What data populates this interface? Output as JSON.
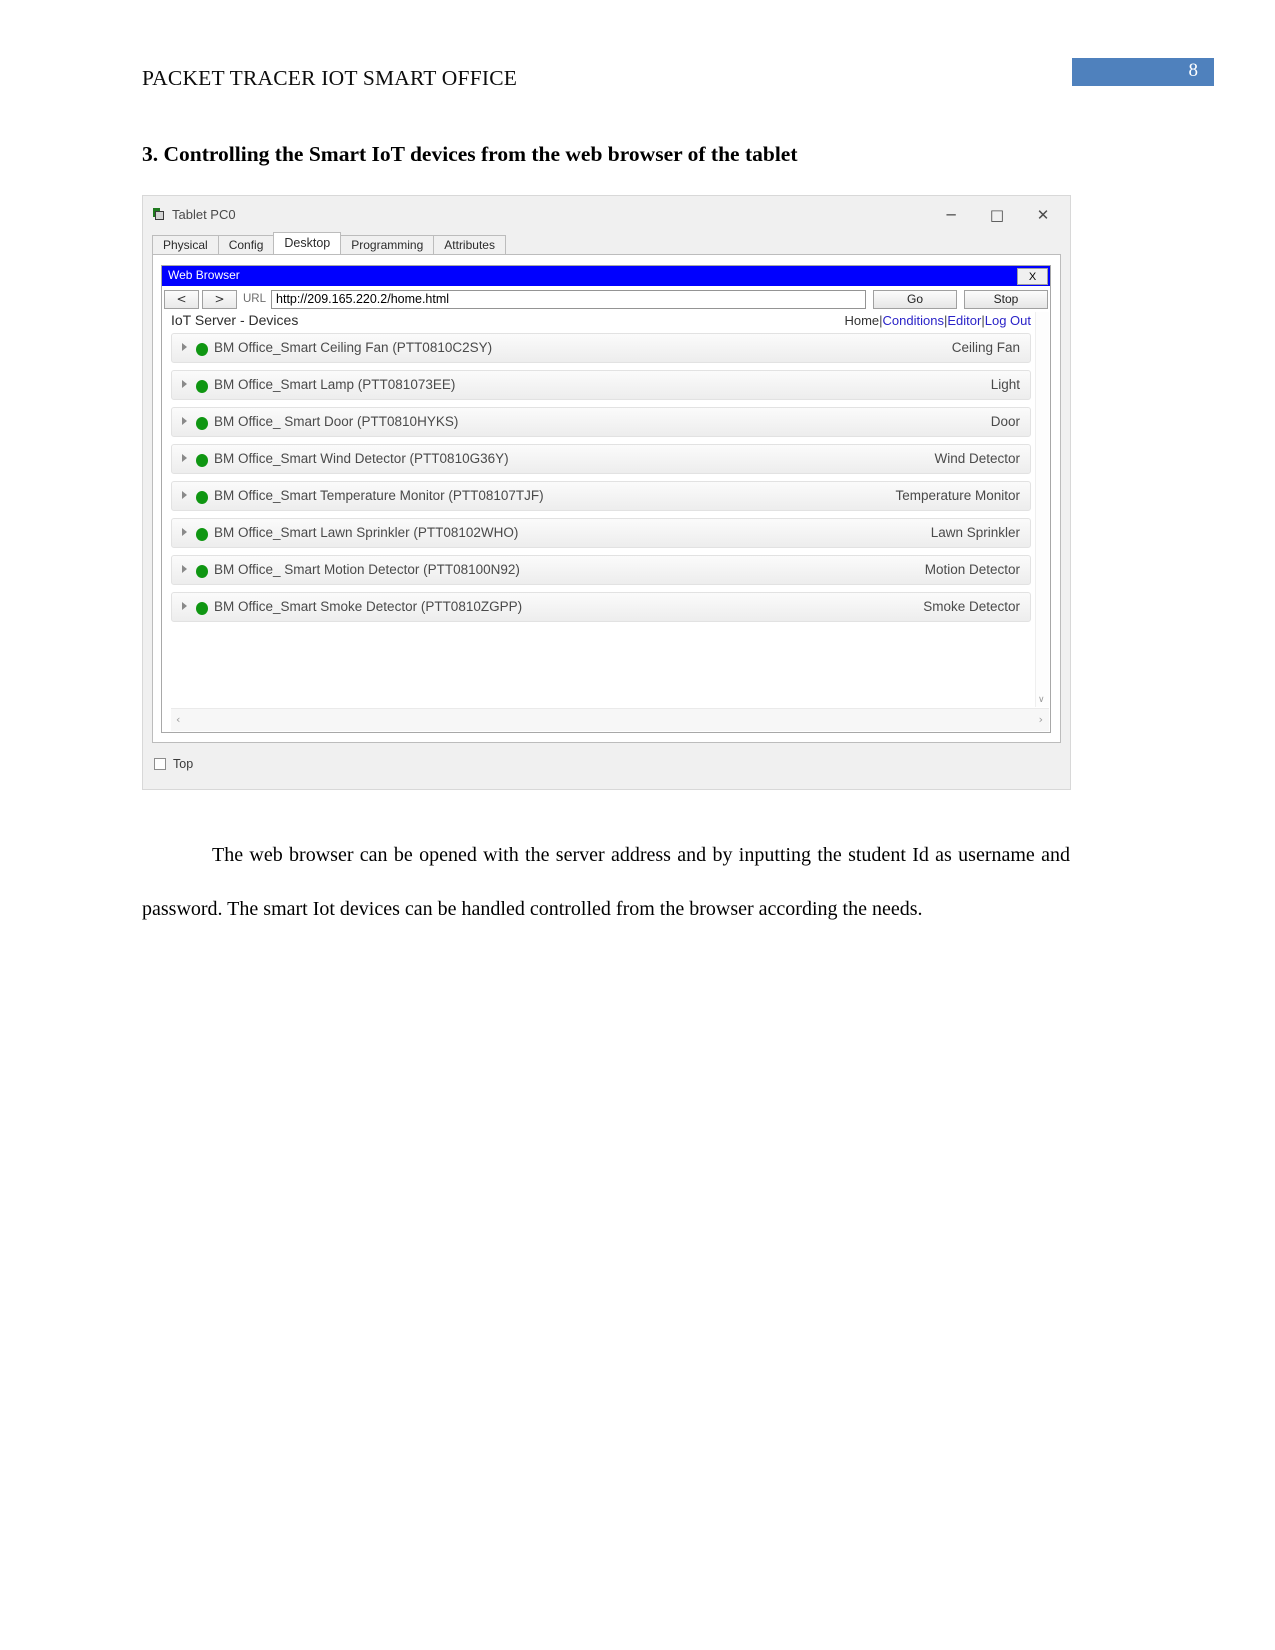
{
  "document": {
    "header_title": "PACKET TRACER IOT SMART OFFICE",
    "page_number": "8",
    "page_number_color": "#4f81bd",
    "section_heading": "3. Controlling the Smart IoT devices from the web browser of the tablet",
    "body_paragraph": "The web browser can be opened with the server address and by inputting the student Id as username and password. The smart Iot devices can be handled controlled from the browser according the needs."
  },
  "window": {
    "title": "Tablet PC0",
    "icon": "packet-tracer-icon",
    "minimize": "─",
    "maximize": "□",
    "close": "✕",
    "tabs": [
      {
        "label": "Physical",
        "active": false
      },
      {
        "label": "Config",
        "active": false
      },
      {
        "label": "Desktop",
        "active": true
      },
      {
        "label": "Programming",
        "active": false
      },
      {
        "label": "Attributes",
        "active": false
      }
    ],
    "footer": {
      "top_checkbox_label": "Top",
      "top_checkbox_checked": false
    }
  },
  "browser": {
    "title": "Web Browser",
    "title_bg": "#0000ff",
    "close_label": "X",
    "back_label": "<",
    "forward_label": ">",
    "url_label": "URL",
    "url_value": "http://209.165.220.2/home.html",
    "url_placeholder": "http://",
    "go_label": "Go",
    "stop_label": "Stop"
  },
  "iot_page": {
    "title": "IoT Server - Devices",
    "nav": {
      "home": "Home",
      "separator": "|",
      "conditions": "Conditions",
      "editor": "Editor",
      "logout": "Log Out",
      "link_color": "#2a23c8",
      "caret": "∧"
    },
    "scroll": {
      "up_arrow": "∧",
      "down_arrow": "∨",
      "left_arrow": "‹",
      "right_arrow": "›"
    },
    "status_color": "#0f9612",
    "devices": [
      {
        "name": "BM Office_Smart Ceiling Fan (PTT0810C2SY)",
        "type": "Ceiling Fan",
        "status": "on"
      },
      {
        "name": "BM Office_Smart Lamp (PTT081073EE)",
        "type": "Light",
        "status": "on"
      },
      {
        "name": "BM Office_ Smart Door (PTT0810HYKS)",
        "type": "Door",
        "status": "on"
      },
      {
        "name": "BM Office_Smart Wind Detector (PTT0810G36Y)",
        "type": "Wind Detector",
        "status": "on"
      },
      {
        "name": "BM Office_Smart Temperature Monitor (PTT08107TJF)",
        "type": "Temperature Monitor",
        "status": "on"
      },
      {
        "name": "BM Office_Smart Lawn Sprinkler (PTT08102WHO)",
        "type": "Lawn Sprinkler",
        "status": "on"
      },
      {
        "name": "BM Office_ Smart Motion Detector (PTT08100N92)",
        "type": "Motion Detector",
        "status": "on"
      },
      {
        "name": "BM Office_Smart Smoke Detector (PTT0810ZGPP)",
        "type": "Smoke Detector",
        "status": "on"
      }
    ]
  }
}
